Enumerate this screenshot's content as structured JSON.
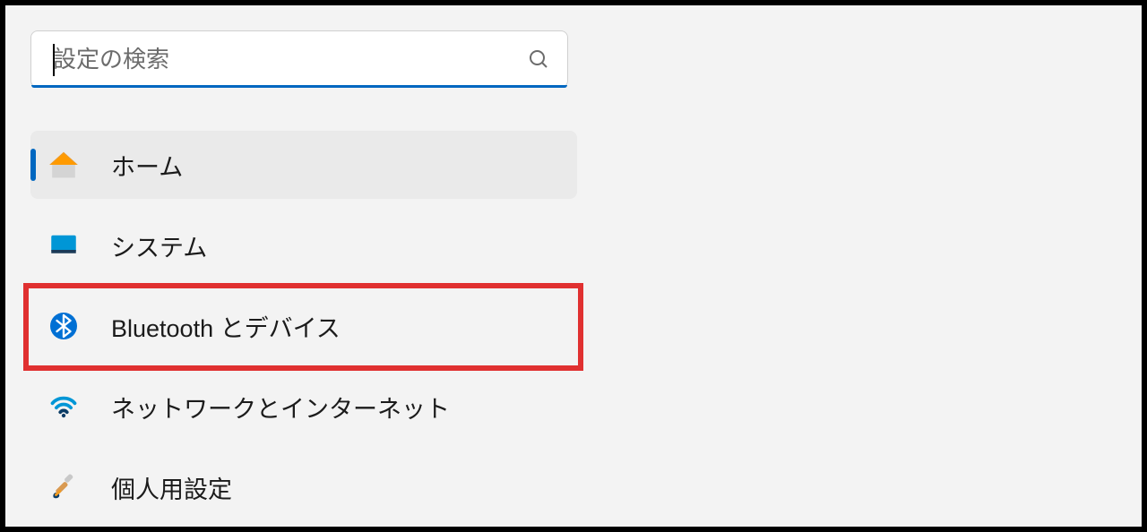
{
  "search": {
    "placeholder": "設定の検索"
  },
  "nav": {
    "items": [
      {
        "id": "home",
        "label": "ホーム",
        "icon": "home-icon",
        "selected": true
      },
      {
        "id": "system",
        "label": "システム",
        "icon": "system-icon",
        "selected": false
      },
      {
        "id": "bluetooth",
        "label": "Bluetooth とデバイス",
        "icon": "bluetooth-icon",
        "selected": false,
        "highlighted": true
      },
      {
        "id": "network",
        "label": "ネットワークとインターネット",
        "icon": "network-icon",
        "selected": false
      },
      {
        "id": "personalize",
        "label": "個人用設定",
        "icon": "personalize-icon",
        "selected": false
      }
    ]
  },
  "colors": {
    "accent": "#0067c0",
    "highlight_border": "#e03030",
    "bg": "#f3f3f3",
    "selected_bg": "#eaeaea"
  }
}
